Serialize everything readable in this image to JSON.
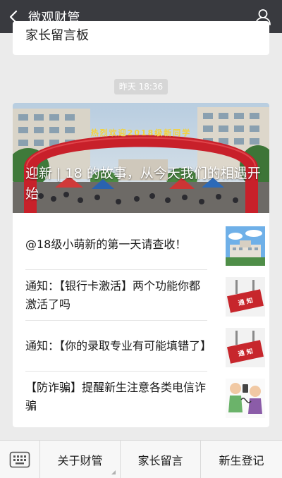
{
  "header": {
    "title": "微观财管",
    "back_icon": "chevron-left-icon",
    "profile_icon": "person-icon"
  },
  "prev_card": {
    "title": "家长留言板"
  },
  "timestamp": "昨天 18:36",
  "article": {
    "cover_banner": "热烈欢迎2018级新同学",
    "cover_title": "迎新 | 18 的故事，从今天我们的相遇开始",
    "items": [
      {
        "title": "@18级小萌新的第一天请查收！",
        "thumb": "campus-photo"
      },
      {
        "title": "通知：【银行卡激活】两个功能你都激活了吗",
        "thumb": "notice-sign",
        "thumb_text": "通 知"
      },
      {
        "title": "通知：【你的录取专业有可能填错了】",
        "thumb": "notice-sign",
        "thumb_text": "通 知"
      },
      {
        "title": "【防诈骗】提醒新生注意各类电信诈骗",
        "thumb": "anti-fraud-cartoon"
      }
    ]
  },
  "menu": {
    "keyboard_icon": "keyboard-icon",
    "buttons": [
      "关于财管",
      "家长留言",
      "新生登记"
    ]
  },
  "colors": {
    "topbar": "#393a3f",
    "background": "#ebebeb",
    "arch_red": "#c8202a",
    "notice_red": "#c7262c"
  }
}
